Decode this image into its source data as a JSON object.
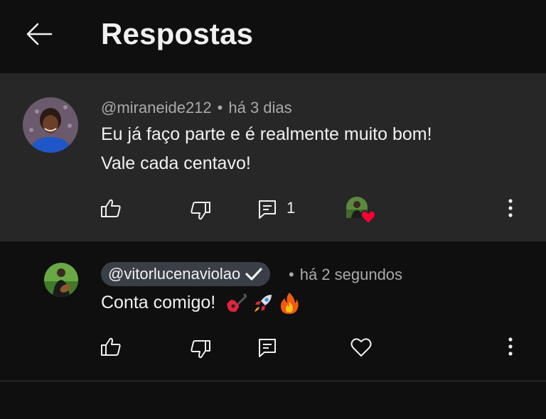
{
  "header": {
    "title": "Respostas",
    "back_icon": "arrow-left-icon"
  },
  "comment": {
    "handle": "@miraneide212",
    "separator": "•",
    "time": "há 3 dias",
    "line1": "Eu já faço parte e é realmente muito bom!",
    "line2": "Vale cada centavo!",
    "reply_count": "1",
    "icons": [
      "thumb-up-icon",
      "thumb-down-icon",
      "reply-icon",
      "creator-heart-icon",
      "more-vert-icon"
    ]
  },
  "reply": {
    "handle": "@vitorlucenaviolao",
    "separator": "•",
    "time": "há 2 segundos",
    "text": "Conta comigo!",
    "emojis": [
      "guitar-emoji",
      "rocket-emoji",
      "fire-emoji"
    ],
    "icons": [
      "thumb-up-icon",
      "thumb-down-icon",
      "reply-icon",
      "heart-outline-icon",
      "more-vert-icon"
    ]
  },
  "colors": {
    "background": "#0f0f0f",
    "highlight": "#272727",
    "text": "#f1f1f1",
    "muted": "#aaaaaa",
    "heart": "#ff0033"
  }
}
